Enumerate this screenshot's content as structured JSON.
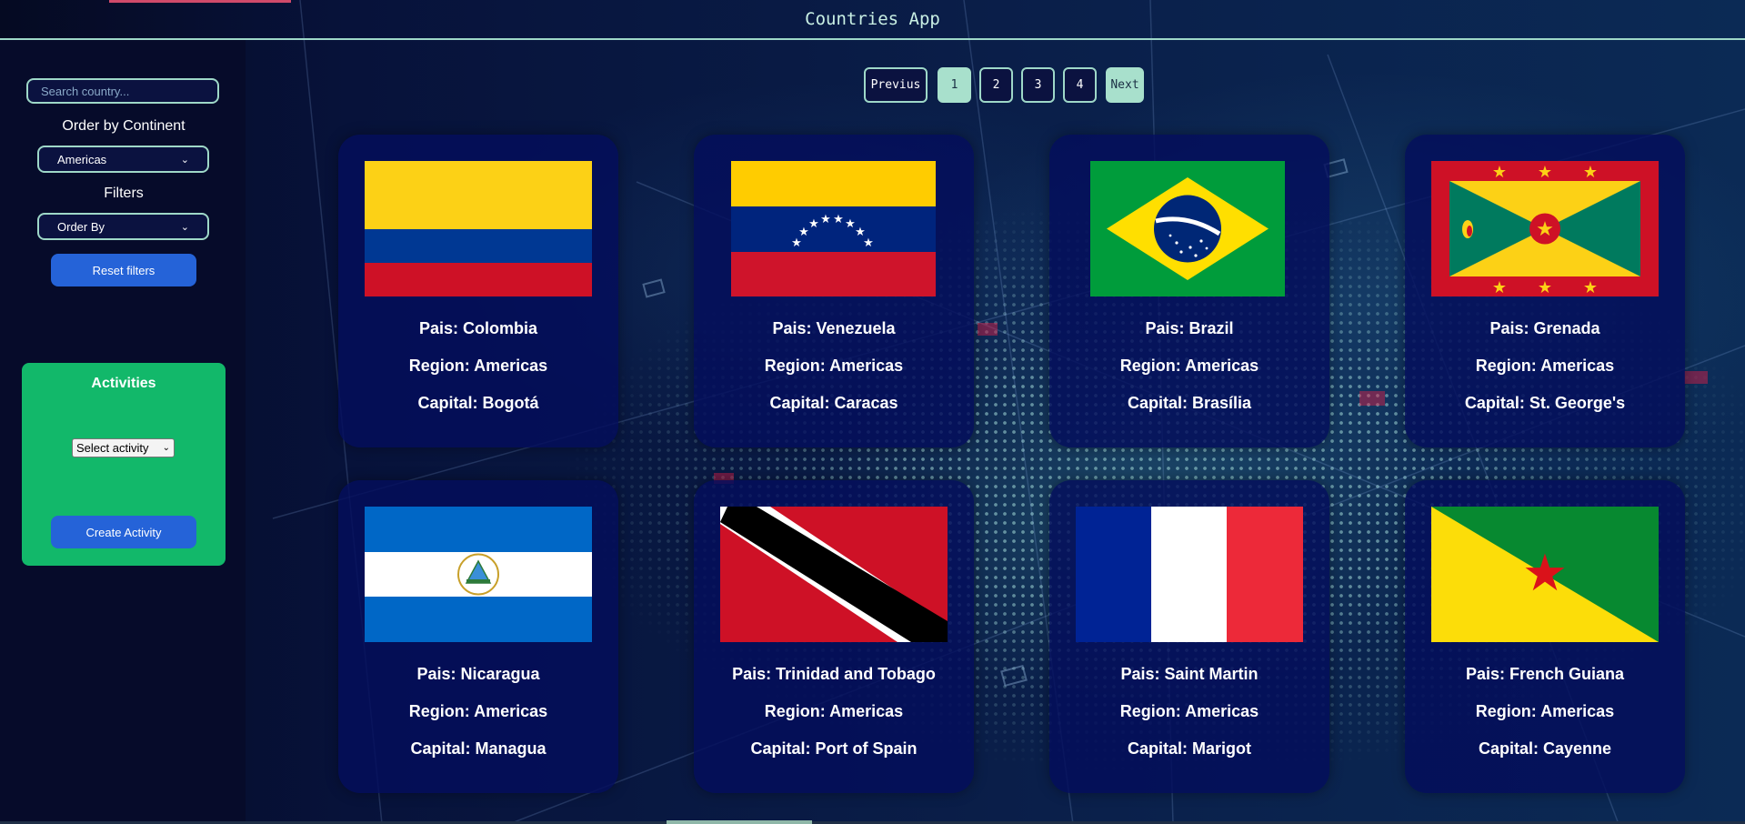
{
  "header": {
    "title": "Countries App"
  },
  "sidebar": {
    "search": {
      "placeholder": "Search country..."
    },
    "order_by_continent": {
      "label": "Order by Continent",
      "selected": "Americas"
    },
    "filters": {
      "label": "Filters",
      "selected": "Order By"
    },
    "reset_label": "Reset filters"
  },
  "activities": {
    "title": "Activities",
    "select_label": "Select activity",
    "create_label": "Create Activity",
    "color": "#12b86a"
  },
  "pagination": {
    "previous": "Previus",
    "pages": [
      "1",
      "2",
      "3",
      "4"
    ],
    "current_page": "1",
    "next": "Next"
  },
  "cards": [
    {
      "pais": "Pais: Colombia",
      "region": "Region: Americas",
      "capital": "Capital: Bogotá",
      "flag": "colombia-flag"
    },
    {
      "pais": "Pais: Venezuela",
      "region": "Region: Americas",
      "capital": "Capital: Caracas",
      "flag": "venezuela-flag"
    },
    {
      "pais": "Pais: Brazil",
      "region": "Region: Americas",
      "capital": "Capital: Brasília",
      "flag": "brazil-flag"
    },
    {
      "pais": "Pais: Grenada",
      "region": "Region: Americas",
      "capital": "Capital: St. George's",
      "flag": "grenada-flag"
    },
    {
      "pais": "Pais: Nicaragua",
      "region": "Region: Americas",
      "capital": "Capital: Managua",
      "flag": "nicaragua-flag"
    },
    {
      "pais": "Pais: Trinidad and Tobago",
      "region": "Region: Americas",
      "capital": "Capital: Port of Spain",
      "flag": "trinidad-and-tobago-flag"
    },
    {
      "pais": "Pais: Saint Martin",
      "region": "Region: Americas",
      "capital": "Capital: Marigot",
      "flag": "saint-martin-flag"
    },
    {
      "pais": "Pais: French Guiana",
      "region": "Region: Americas",
      "capital": "Capital: Cayenne",
      "flag": "french-guiana-flag"
    }
  ],
  "colors": {
    "background": "#070d35",
    "card": "#040e5c",
    "accent_teal": "#9ed8c8",
    "button_blue": "#2563d8"
  }
}
